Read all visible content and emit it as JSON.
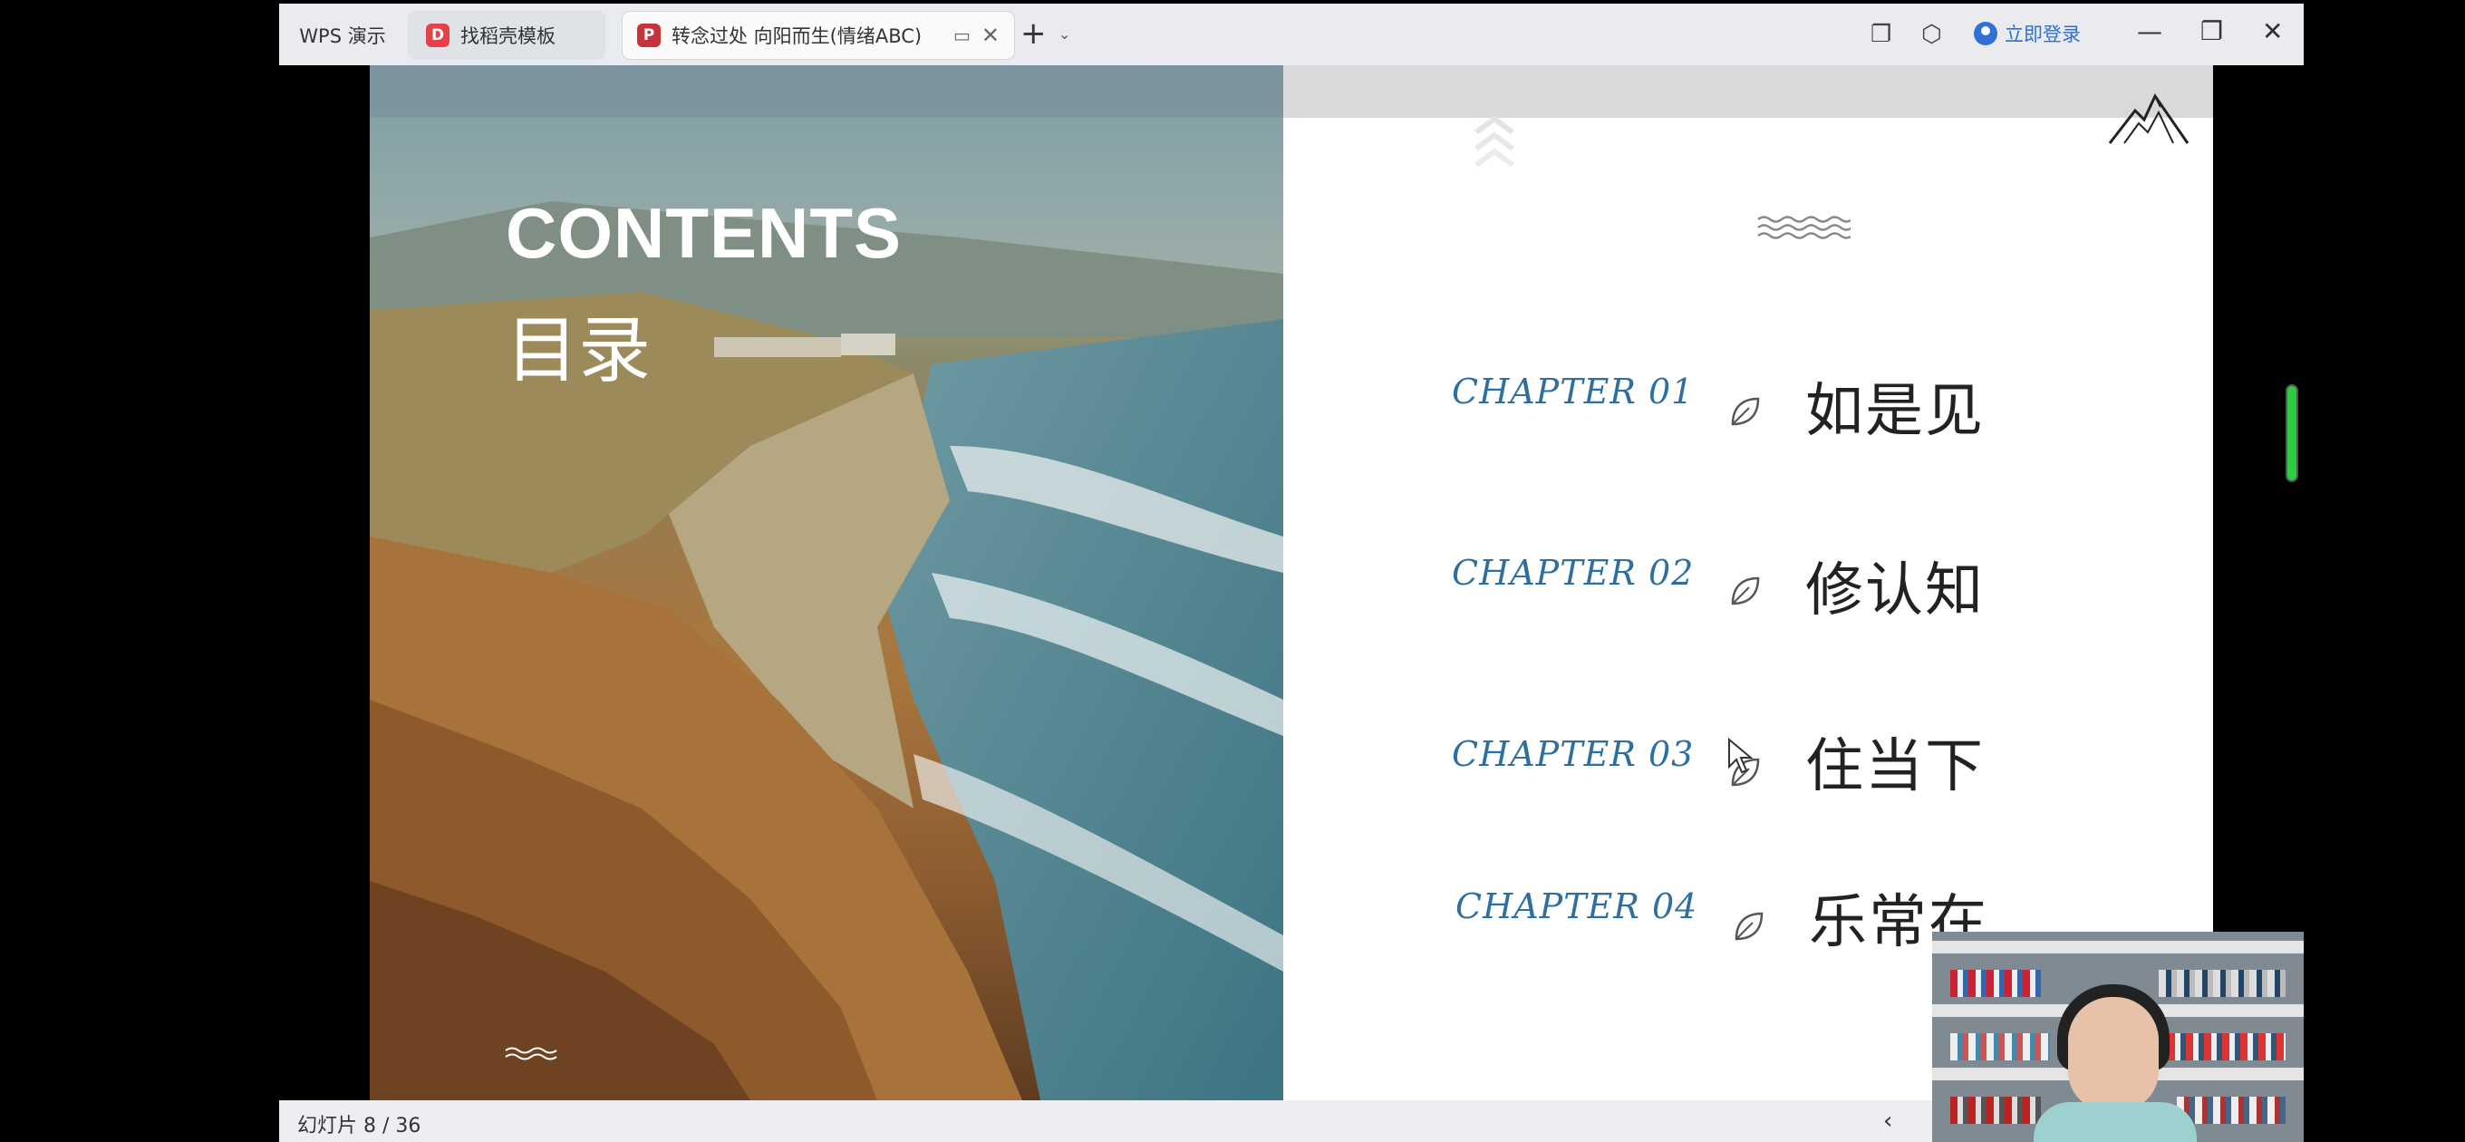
{
  "titlebar": {
    "tabs": [
      {
        "label": "WPS 演示"
      },
      {
        "label": "找稻壳模板",
        "badge": "D"
      },
      {
        "label": "转念过处 向阳而生(情绪ABC)",
        "badge": "P"
      }
    ],
    "new_tab_icon": "plus-icon",
    "login_label": "立即登录"
  },
  "slide": {
    "left": {
      "title": "CONTENTS",
      "subtitle": "目录"
    },
    "chapters": [
      {
        "label": "CHAPTER 01",
        "title": "如是见"
      },
      {
        "label": "CHAPTER 02",
        "title": "修认知"
      },
      {
        "label": "CHAPTER 03",
        "title": "住当下"
      },
      {
        "label": "CHAPTER 04",
        "title": "乐常在"
      }
    ]
  },
  "statusbar": {
    "slide_count": "幻灯片 8 / 36"
  },
  "colors": {
    "chapter_blue": "#2e6fa3",
    "scroll_green": "#2ecc40",
    "login_blue": "#2f6fd6"
  }
}
